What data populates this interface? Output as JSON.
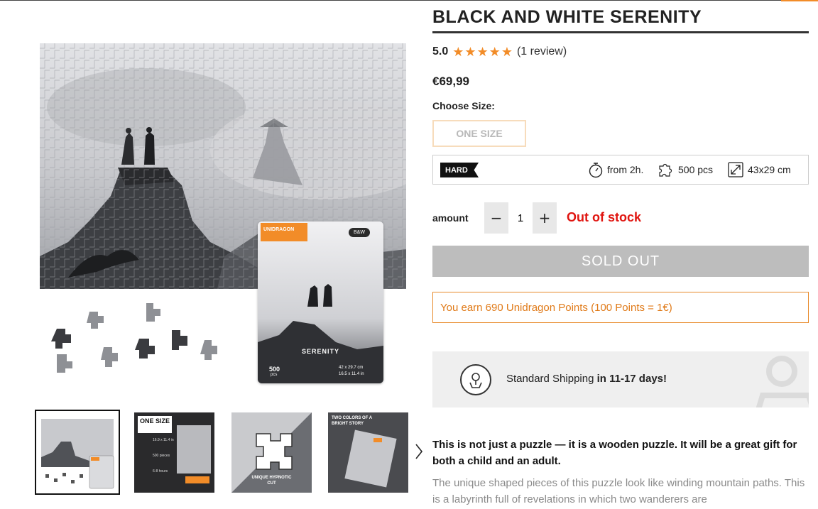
{
  "product": {
    "title": "BLACK AND WHITE SERENITY",
    "rating_score": "5.0",
    "rating_stars": 5,
    "review_text": "(1 review)",
    "price": "€69,99",
    "choose_size_label": "Choose Size:",
    "size_option": "ONE SIZE"
  },
  "specs": {
    "difficulty": "HARD",
    "time": "from 2h.",
    "pieces": "500 pcs",
    "dimensions": "43x29 cm"
  },
  "purchase": {
    "amount_label": "amount",
    "quantity": "1",
    "minus": "−",
    "plus": "+",
    "stock_status": "Out of stock",
    "button_label": "SOLD OUT"
  },
  "points_text": "You earn 690 Unidragon Points (100 Points = 1€)",
  "shipping": {
    "prefix": "Standard Shipping ",
    "highlight": "in 11-17 days!"
  },
  "description": {
    "lead": "This is not just a puzzle — it is a wooden puzzle. It will be a great gift for both a child and an adult.",
    "body": "The unique shaped pieces of this puzzle look like winding mountain paths. This is a labyrinth full of revelations in which two wanderers are"
  },
  "box": {
    "brand": "UNIDRAGON",
    "badge": "B&W",
    "name": "SERENITY",
    "pieces_num": "500",
    "pieces_unit": "pcs",
    "size_cm": "42 x 29.7 cm",
    "size_in": "16.5 x 11.4 in"
  },
  "thumbnails": [
    {
      "caption": ""
    },
    {
      "caption": "ONE SIZE",
      "line1": "16.9 x 11.4 in",
      "line2": "500 pieces",
      "line3": "6-8 hours"
    },
    {
      "caption": "UNIQUE HYPNOTIC CUT"
    },
    {
      "caption": "TWO COLORS OF A BRIGHT STORY"
    }
  ],
  "colors": {
    "accent": "#f28c28",
    "out_of_stock": "#e0140f",
    "sold_out_bg": "#bdbdbd",
    "points_border": "#e88a2a"
  },
  "icons": [
    "star-icon",
    "stopwatch-icon",
    "puzzle-piece-icon",
    "resize-icon",
    "map-pin-icon",
    "chevron-right-icon",
    "minus-icon",
    "plus-icon"
  ]
}
